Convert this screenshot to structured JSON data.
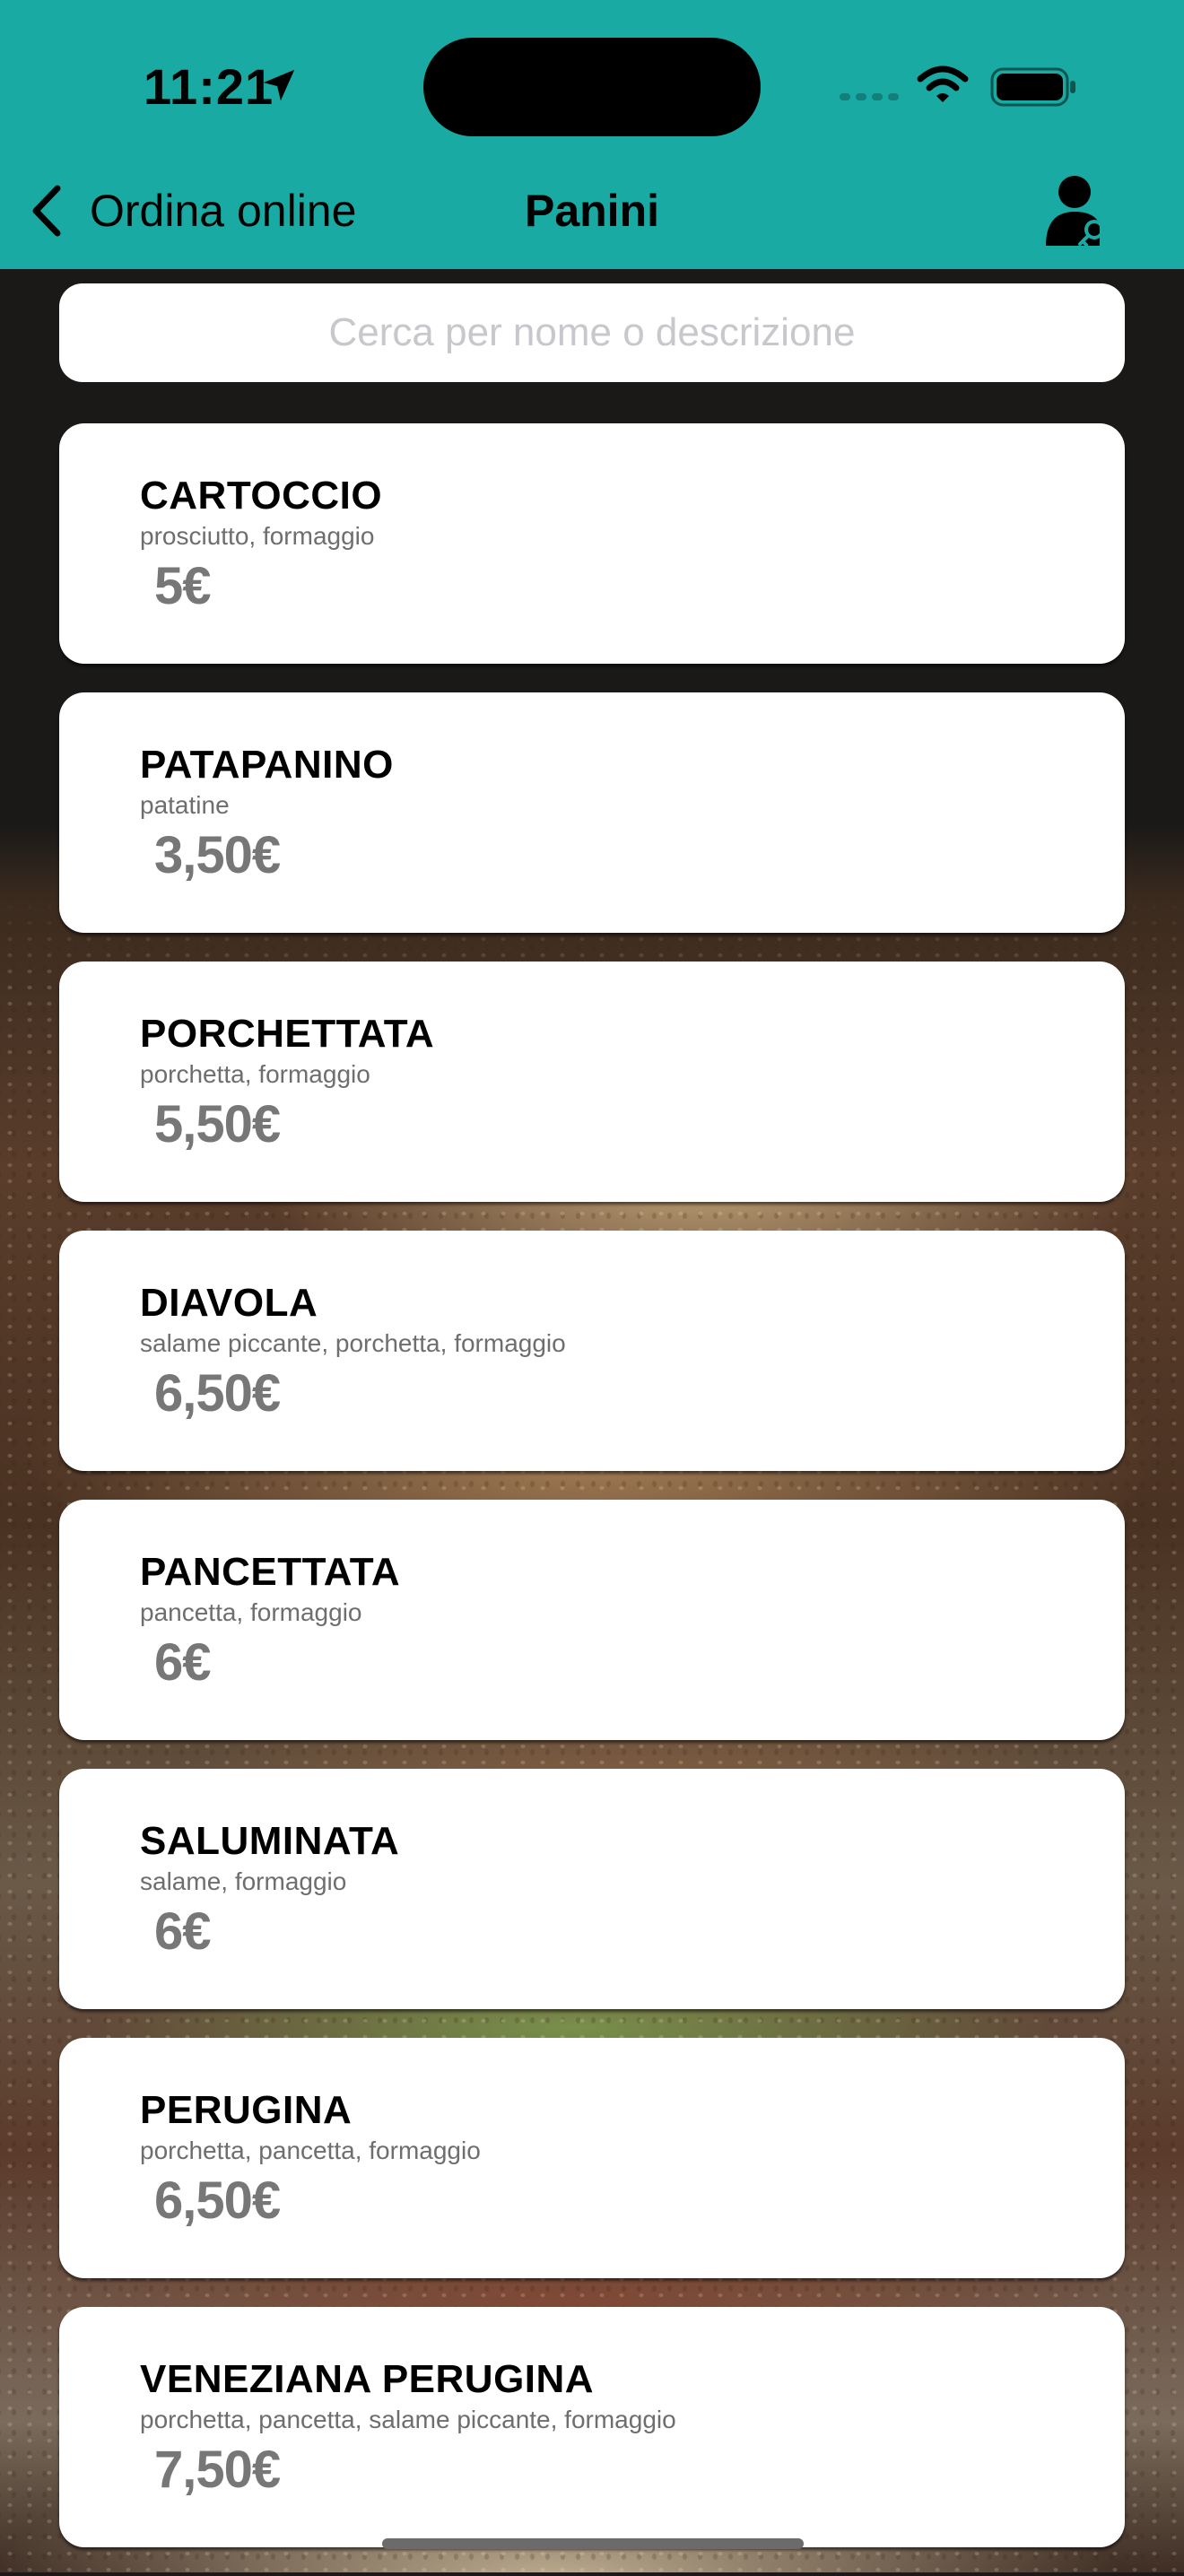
{
  "status_bar": {
    "time": "11:21",
    "icons": [
      "location-arrow-icon",
      "cellular-signal-icon",
      "wifi-icon",
      "battery-icon"
    ]
  },
  "nav": {
    "back_label": "Ordina online",
    "title": "Panini",
    "right_icon": "user-key-icon"
  },
  "search": {
    "placeholder": "Cerca per nome o descrizione",
    "value": ""
  },
  "colors": {
    "header": "#19aaa3",
    "card": "#ffffff",
    "price": "#777777",
    "description": "#6e6e6e"
  },
  "items": [
    {
      "name": "CARTOCCIO",
      "description": "prosciutto, formaggio",
      "price": "5€"
    },
    {
      "name": "PATAPANINO",
      "description": "patatine",
      "price": "3,50€"
    },
    {
      "name": "PORCHETTATA",
      "description": "porchetta, formaggio",
      "price": "5,50€"
    },
    {
      "name": "DIAVOLA",
      "description": "salame piccante, porchetta, formaggio",
      "price": "6,50€"
    },
    {
      "name": "PANCETTATA",
      "description": "pancetta, formaggio",
      "price": "6€"
    },
    {
      "name": "SALUMINATA",
      "description": "salame, formaggio",
      "price": "6€"
    },
    {
      "name": "PERUGINA",
      "description": "porchetta, pancetta, formaggio",
      "price": "6,50€"
    },
    {
      "name": "VENEZIANA PERUGINA",
      "description": "porchetta, pancetta, salame piccante, formaggio",
      "price": "7,50€"
    }
  ]
}
